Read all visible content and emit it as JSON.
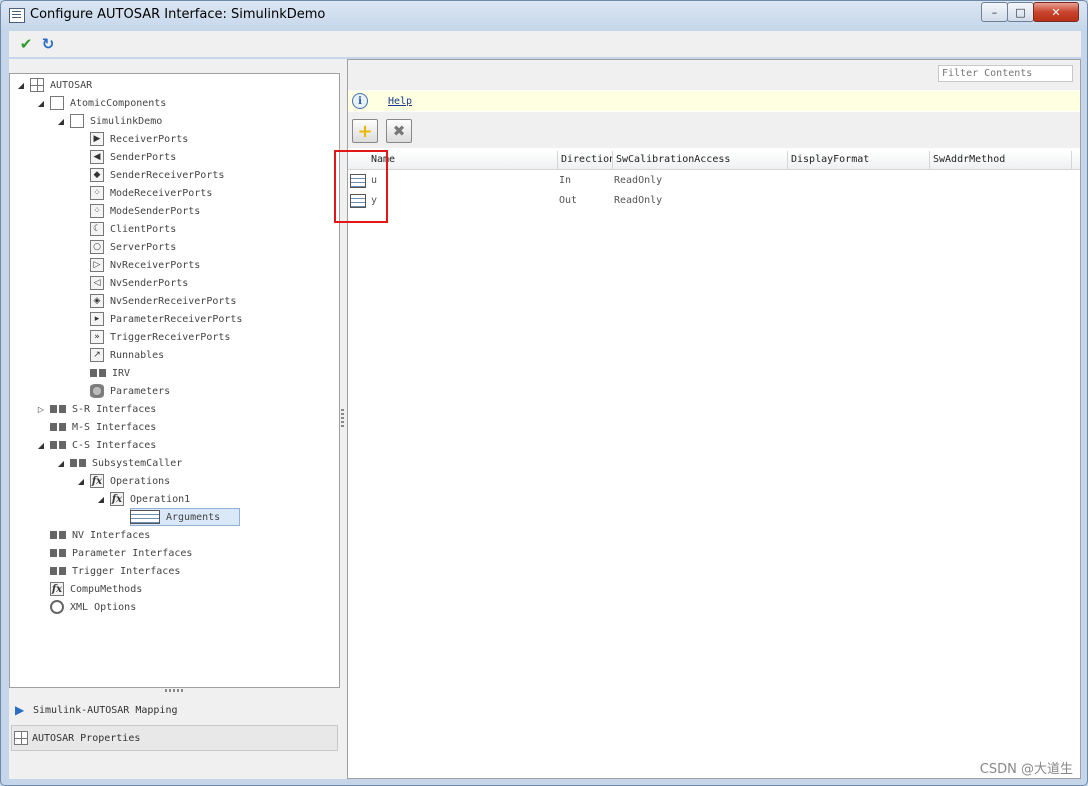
{
  "window": {
    "title": "Configure AUTOSAR Interface: SimulinkDemo",
    "controls": {
      "minimize": "–",
      "maximize": "□",
      "close": "✕"
    }
  },
  "toolbar": {
    "apply_icon": "check-icon",
    "apply_glyph": "✔",
    "refresh_icon": "refresh-icon",
    "refresh_glyph": "↻"
  },
  "tree": [
    {
      "label": "AUTOSAR",
      "expander": "◢",
      "icon": "grid"
    },
    {
      "label": "AtomicComponents",
      "expander": "◢",
      "icon": "sq"
    },
    {
      "label": "SimulinkDemo",
      "expander": "◢",
      "icon": "sq"
    },
    {
      "label": "ReceiverPorts",
      "expander": "",
      "icon": "▶"
    },
    {
      "label": "SenderPorts",
      "expander": "",
      "icon": "◀"
    },
    {
      "label": "SenderReceiverPorts",
      "expander": "",
      "icon": "◆"
    },
    {
      "label": "ModeReceiverPorts",
      "expander": "",
      "icon": "⁘"
    },
    {
      "label": "ModeSenderPorts",
      "expander": "",
      "icon": "⁘"
    },
    {
      "label": "ClientPorts",
      "expander": "",
      "icon": "☾"
    },
    {
      "label": "ServerPorts",
      "expander": "",
      "icon": "○"
    },
    {
      "label": "NvReceiverPorts",
      "expander": "",
      "icon": "▷"
    },
    {
      "label": "NvSenderPorts",
      "expander": "",
      "icon": "◁"
    },
    {
      "label": "NvSenderReceiverPorts",
      "expander": "",
      "icon": "◈"
    },
    {
      "label": "ParameterReceiverPorts",
      "expander": "",
      "icon": "▸"
    },
    {
      "label": "TriggerReceiverPorts",
      "expander": "",
      "icon": "»"
    },
    {
      "label": "Runnables",
      "expander": "",
      "icon": "↗"
    },
    {
      "label": "IRV",
      "expander": "",
      "icon": "iface"
    },
    {
      "label": "Parameters",
      "expander": "",
      "icon": "db"
    },
    {
      "label": "S-R Interfaces",
      "expander": "▷",
      "icon": "iface"
    },
    {
      "label": "M-S Interfaces",
      "expander": "",
      "icon": "iface"
    },
    {
      "label": "C-S Interfaces",
      "expander": "◢",
      "icon": "iface"
    },
    {
      "label": "SubsystemCaller",
      "expander": "◢",
      "icon": "iface"
    },
    {
      "label": "Operations",
      "expander": "◢",
      "icon": "fx"
    },
    {
      "label": "Operation1",
      "expander": "◢",
      "icon": "fx"
    },
    {
      "label": "Arguments",
      "expander": "",
      "icon": "args",
      "selected": true
    },
    {
      "label": "NV Interfaces",
      "expander": "",
      "icon": "iface"
    },
    {
      "label": "Parameter Interfaces",
      "expander": "",
      "icon": "iface"
    },
    {
      "label": "Trigger Interfaces",
      "expander": "",
      "icon": "iface"
    },
    {
      "label": "CompuMethods",
      "expander": "",
      "icon": "fx"
    },
    {
      "label": "XML Options",
      "expander": "",
      "icon": "gear"
    }
  ],
  "bottom_nav": {
    "mapping": "Simulink-AUTOSAR Mapping",
    "properties": "AUTOSAR Properties"
  },
  "right": {
    "filter_placeholder": "Filter Contents",
    "help_icon": "i",
    "help_link": "Help",
    "add_button": "+",
    "delete_button": "✖",
    "columns": [
      "Name",
      "Direction",
      "SwCalibrationAccess",
      "DisplayFormat",
      "SwAddrMethod"
    ],
    "rows": [
      {
        "name": "u",
        "direction": "In",
        "access": "ReadOnly",
        "format": "",
        "addr": ""
      },
      {
        "name": "y",
        "direction": "Out",
        "access": "ReadOnly",
        "format": "",
        "addr": ""
      }
    ]
  },
  "colors": {
    "highlight": "#e21818",
    "selection": "#dbe8f8",
    "help_bg": "#ffffe1"
  },
  "watermark": "CSDN @大道生"
}
